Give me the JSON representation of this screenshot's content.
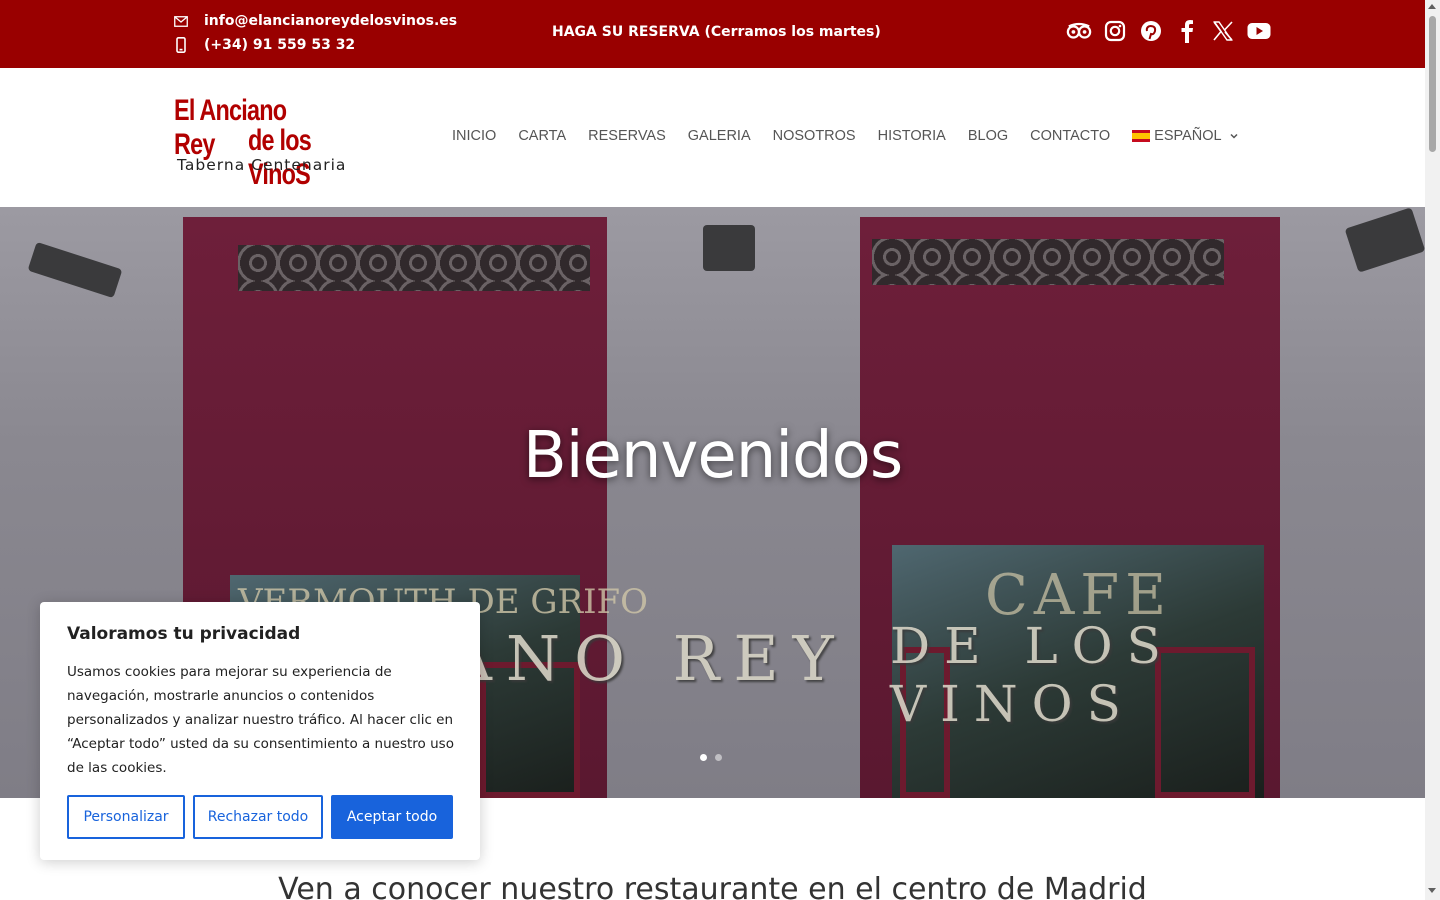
{
  "topbar": {
    "email": "info@elancianoreydelosvinos.es",
    "phone": "(+34) 91 559 53 32",
    "reserve_text": "HAGA SU RESERVA (Cerramos los martes)",
    "bg_color": "#990000",
    "social_icons": [
      "tripadvisor-icon",
      "instagram-icon",
      "pinterest-icon",
      "facebook-icon",
      "x-twitter-icon",
      "youtube-icon"
    ]
  },
  "logo": {
    "line1": "El Anciano Rey",
    "line2": "de los VinoS",
    "line3": "Taberna Centenaria"
  },
  "nav": {
    "items": [
      "INICIO",
      "CARTA",
      "RESERVAS",
      "GALERIA",
      "NOSOTROS",
      "HISTORIA",
      "BLOG",
      "CONTACTO"
    ],
    "language": "ESPAÑOL"
  },
  "hero": {
    "title": "Bienvenidos",
    "sign_left": "EL ANCIANO REY",
    "sign_right": "DE LOS VINOS",
    "window_left_text": "VERMOUTH DE GRIFO",
    "window_right_text": "CAFE",
    "slides": 2,
    "active_slide": 1
  },
  "intro": {
    "heading": "Ven a conocer nuestro restaurante en el centro de Madrid"
  },
  "cookie": {
    "title": "Valoramos tu privacidad",
    "text": "Usamos cookies para mejorar su experiencia de navegación, mostrarle anuncios o contenidos personalizados y analizar nuestro tráfico. Al hacer clic en “Aceptar todo” usted da su consentimiento a nuestro uso de las cookies.",
    "customize_label": "Personalizar",
    "reject_label": "Rechazar todo",
    "accept_label": "Aceptar todo",
    "accent_color": "#1863dc"
  }
}
